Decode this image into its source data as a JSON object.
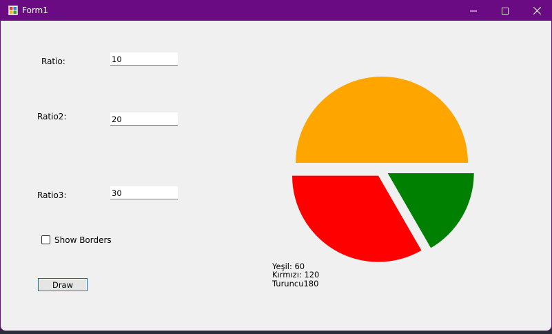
{
  "window": {
    "title": "Form1",
    "controls": {
      "minimize": "minimize",
      "maximize": "maximize",
      "close": "close"
    }
  },
  "form": {
    "ratio_label": "Ratio:",
    "ratio_value": "10",
    "ratio2_label": "Ratio2:",
    "ratio2_value": "20",
    "ratio3_label": "Ratio3:",
    "ratio3_value": "30",
    "show_borders_label": "Show Borders",
    "show_borders_checked": false,
    "draw_label": "Draw"
  },
  "legend": [
    "Yeşil: 60",
    "Kırmızı: 120",
    "Turuncu180"
  ],
  "chart_data": {
    "type": "pie",
    "slices": [
      {
        "value": 180,
        "color": "#ffa500"
      },
      {
        "value": 60,
        "color": "#008000"
      },
      {
        "value": 120,
        "color": "#ff0000"
      }
    ]
  },
  "colors": {
    "titlebar": "#6b0b84",
    "form_background": "#f0f0f0",
    "button_focus_border": "#0067c0"
  }
}
